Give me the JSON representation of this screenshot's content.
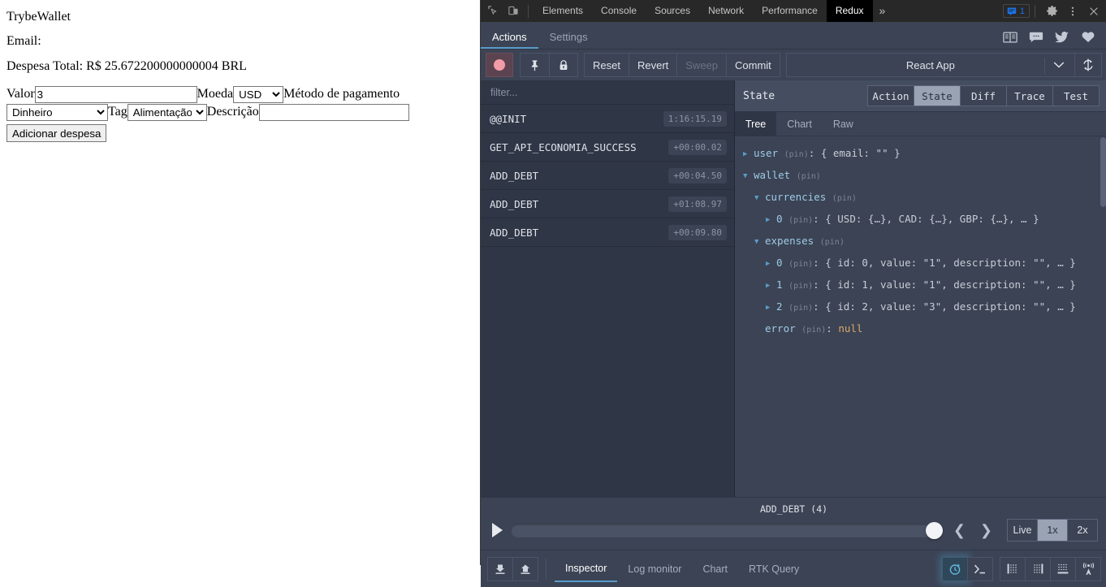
{
  "app": {
    "title": "TrybeWallet",
    "email_label": "Email:",
    "total_label": "Despesa Total: R$ 25.672200000000004 BRL",
    "form": {
      "valor_label": "Valor",
      "valor_value": "3",
      "moeda_label": "Moeda",
      "moeda_value": "USD",
      "metodo_label": "Método de pagamento",
      "metodo_value": "Dinheiro",
      "tag_label": "Tag",
      "tag_value": "Alimentação",
      "descricao_label": "Descrição",
      "descricao_value": "",
      "submit_label": "Adicionar despesa"
    }
  },
  "devtools": {
    "tabs": [
      {
        "label": "Elements",
        "active": false
      },
      {
        "label": "Console",
        "active": false
      },
      {
        "label": "Sources",
        "active": false
      },
      {
        "label": "Network",
        "active": false
      },
      {
        "label": "Performance",
        "active": false
      },
      {
        "label": "Redux",
        "active": true
      }
    ],
    "more_label": "»",
    "issues_count": "1",
    "icons": {
      "inspect": "inspect-element-icon",
      "device": "device-toolbar-icon",
      "issues": "issues-badge-icon",
      "settings": "gear-icon",
      "menu": "kebab-menu-icon",
      "close": "close-icon"
    }
  },
  "redux": {
    "tabs": [
      {
        "label": "Actions",
        "active": true
      },
      {
        "label": "Settings",
        "active": false
      }
    ],
    "header_icons": [
      "book-icon",
      "chat-icon",
      "twitter-icon",
      "heart-icon"
    ],
    "toolbar": {
      "record_label": "record-button",
      "pin_label": "pin-button",
      "lock_label": "lock-button",
      "reset_label": "Reset",
      "revert_label": "Revert",
      "sweep_label": "Sweep",
      "commit_label": "Commit",
      "instance_label": "React App",
      "refresh_label": "refresh-button"
    },
    "actions": {
      "filter_placeholder": "filter...",
      "rows": [
        {
          "name": "@@INIT",
          "time": "1:16:15.19"
        },
        {
          "name": "GET_API_ECONOMIA_SUCCESS",
          "time": "+00:00.02"
        },
        {
          "name": "ADD_DEBT",
          "time": "+00:04.50"
        },
        {
          "name": "ADD_DEBT",
          "time": "+01:08.97"
        },
        {
          "name": "ADD_DEBT",
          "time": "+00:09.80"
        }
      ]
    },
    "state_panel": {
      "title": "State",
      "segments": [
        {
          "label": "Action",
          "active": false
        },
        {
          "label": "State",
          "active": true
        },
        {
          "label": "Diff",
          "active": false
        },
        {
          "label": "Trace",
          "active": false
        },
        {
          "label": "Test",
          "active": false
        }
      ],
      "subtabs": [
        {
          "label": "Tree",
          "active": true
        },
        {
          "label": "Chart",
          "active": false
        },
        {
          "label": "Raw",
          "active": false
        }
      ],
      "pin_label": "(pin)",
      "tree": [
        {
          "indent": 0,
          "arrow": "collapsed",
          "key": "user",
          "sep": ": ",
          "value": "{ email: \"\" }"
        },
        {
          "indent": 0,
          "arrow": "expanded",
          "key": "wallet",
          "sep": "",
          "value": ""
        },
        {
          "indent": 1,
          "arrow": "expanded",
          "key": "currencies",
          "sep": "",
          "value": ""
        },
        {
          "indent": 2,
          "arrow": "collapsed",
          "key": "0",
          "sep": ": ",
          "value": "{ USD: {…}, CAD: {…}, GBP: {…}, … }"
        },
        {
          "indent": 1,
          "arrow": "expanded",
          "key": "expenses",
          "sep": "",
          "value": ""
        },
        {
          "indent": 2,
          "arrow": "collapsed",
          "key": "0",
          "sep": ": ",
          "value": "{ id: 0, value: \"1\", description: \"\", … }"
        },
        {
          "indent": 2,
          "arrow": "collapsed",
          "key": "1",
          "sep": ": ",
          "value": "{ id: 1, value: \"1\", description: \"\", … }"
        },
        {
          "indent": 2,
          "arrow": "collapsed",
          "key": "2",
          "sep": ": ",
          "value": "{ id: 2, value: \"3\", description: \"\", … }"
        },
        {
          "indent": 1,
          "arrow": "none",
          "key": "error",
          "sep": ": ",
          "value": "null"
        }
      ]
    },
    "slider": {
      "current_action": "ADD_DEBT  (4)",
      "play_label": "play-button",
      "prev_label": "previous-action-button",
      "next_label": "next-action-button",
      "speeds": [
        {
          "label": "Live",
          "active": false
        },
        {
          "label": "1x",
          "active": true
        },
        {
          "label": "2x",
          "active": false
        }
      ]
    },
    "bottom": {
      "import_label": "import-button",
      "export_label": "export-button",
      "monitors": [
        {
          "label": "Inspector",
          "active": true
        },
        {
          "label": "Log monitor",
          "active": false
        },
        {
          "label": "Chart",
          "active": false
        },
        {
          "label": "RTK Query",
          "active": false
        }
      ],
      "right_icons": [
        "timer-icon",
        "terminal-icon",
        "dock-left-icon",
        "dock-right-icon",
        "dock-bottom-icon",
        "remote-icon"
      ]
    }
  },
  "colors": {
    "devtools_bg": "#282828",
    "redux_bg": "#3b4354",
    "actions_bg": "#2f3646",
    "accent": "#5a9cc9",
    "key": "#9ecbe6",
    "value": "#d9a96a",
    "issues_blue": "#1a73e8",
    "record_pink": "#f29ca8"
  }
}
